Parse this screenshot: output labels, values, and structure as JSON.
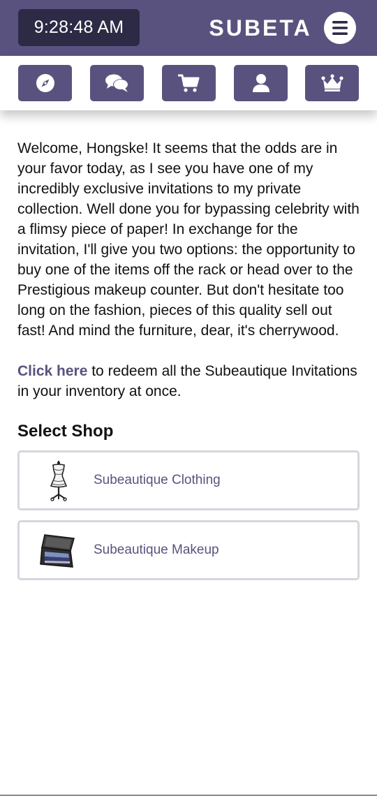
{
  "header": {
    "clock": "9:28:48 AM",
    "brand": "SUBETA",
    "menu_icon": "hamburger-icon",
    "background_color": "#5a527e",
    "clock_color": "#2d2a45"
  },
  "nav": {
    "items": [
      {
        "icon": "compass-icon",
        "name": "explore"
      },
      {
        "icon": "chat-bubbles-icon",
        "name": "forums"
      },
      {
        "icon": "shopping-cart-icon",
        "name": "shops"
      },
      {
        "icon": "user-icon",
        "name": "profile"
      },
      {
        "icon": "crown-icon",
        "name": "premium"
      }
    ]
  },
  "main": {
    "intro": "Welcome, Hongske! It seems that the odds are in your favor today, as I see you have one of my incredibly exclusive invitations to my private collection. Well done you for bypassing celebrity with a flimsy piece of paper! In exchange for the invitation, I'll give you two options: the opportunity to buy one of the items off the rack or head over to the Prestigious makeup counter. But don't hesitate too long on the fashion, pieces of this quality sell out fast! And mind the furniture, dear, it's cherrywood.",
    "redeem_link": "Click here",
    "redeem_text": " to redeem all the Subeautique Invitations in your inventory at once.",
    "select_title": "Select Shop",
    "shops": [
      {
        "label": "Subeautique Clothing",
        "icon": "dress-form-icon"
      },
      {
        "label": "Subeautique Makeup",
        "icon": "eyeshadow-palette-icon"
      }
    ]
  },
  "colors": {
    "accent": "#5a527e",
    "card_border": "#d7d5dd",
    "text": "#111111"
  }
}
